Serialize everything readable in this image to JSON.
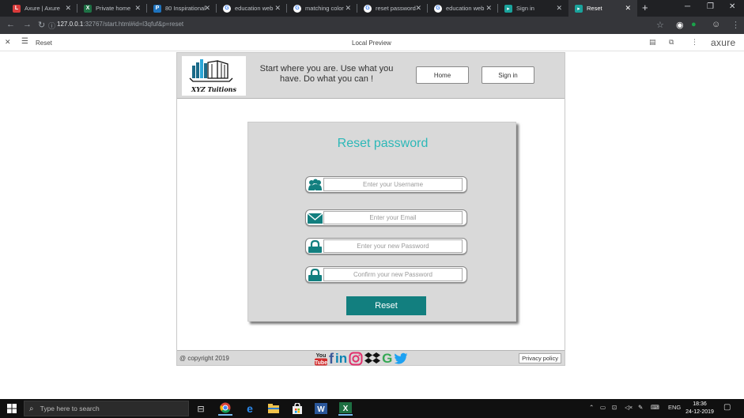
{
  "browser": {
    "tabs": [
      {
        "title": "Axure | Axure",
        "favicon": "axure-favicon",
        "color": "#d93b3b",
        "glyph": "L"
      },
      {
        "title": "Private home",
        "favicon": "excel-favicon",
        "color": "#1e7145",
        "glyph": "X"
      },
      {
        "title": "80 Inspirational",
        "favicon": "pinterest-favicon",
        "color": "#1e73be",
        "glyph": "P"
      },
      {
        "title": "education web",
        "favicon": "google-favicon",
        "color": "#ffffff",
        "glyph": "G"
      },
      {
        "title": "matching color",
        "favicon": "google-favicon",
        "color": "#ffffff",
        "glyph": "G"
      },
      {
        "title": "reset password",
        "favicon": "google-favicon",
        "color": "#ffffff",
        "glyph": "G"
      },
      {
        "title": "education web",
        "favicon": "google-favicon",
        "color": "#ffffff",
        "glyph": "G"
      },
      {
        "title": "Sign in",
        "favicon": "axure-play-favicon",
        "color": "#1aa39c",
        "glyph": "▸"
      },
      {
        "title": "Reset",
        "favicon": "axure-play-favicon",
        "color": "#1aa39c",
        "glyph": "▸",
        "active": true
      }
    ],
    "url_host": "127.0.0.1",
    "url_rest": ":32767/start.html#id=l3qfuf&p=reset"
  },
  "axure": {
    "page_name": "Reset",
    "mode": "Local Preview",
    "brand": "axure"
  },
  "site": {
    "logo_text": "XYZ Tuitions",
    "tagline": "Start where you are. Use what you have. Do what you can !",
    "nav": {
      "home": "Home",
      "signin": "Sign in"
    },
    "form": {
      "title": "Reset password",
      "username_placeholder": "Enter your Username",
      "email_placeholder": "Enter your Email",
      "password_placeholder": "Enter your new Password",
      "confirm_placeholder": "Confirm your new Password",
      "submit": "Reset"
    },
    "footer": {
      "copyright": "@ copyright 2019",
      "privacy": "Privacy policy",
      "youtube_top": "You",
      "youtube_bottom": "Tube"
    },
    "colors": {
      "accent": "#127f7f",
      "title": "#2cb8b8"
    }
  },
  "taskbar": {
    "search_placeholder": "Type here to search",
    "lang": "ENG",
    "time": "18:36",
    "date": "24-12-2019"
  }
}
